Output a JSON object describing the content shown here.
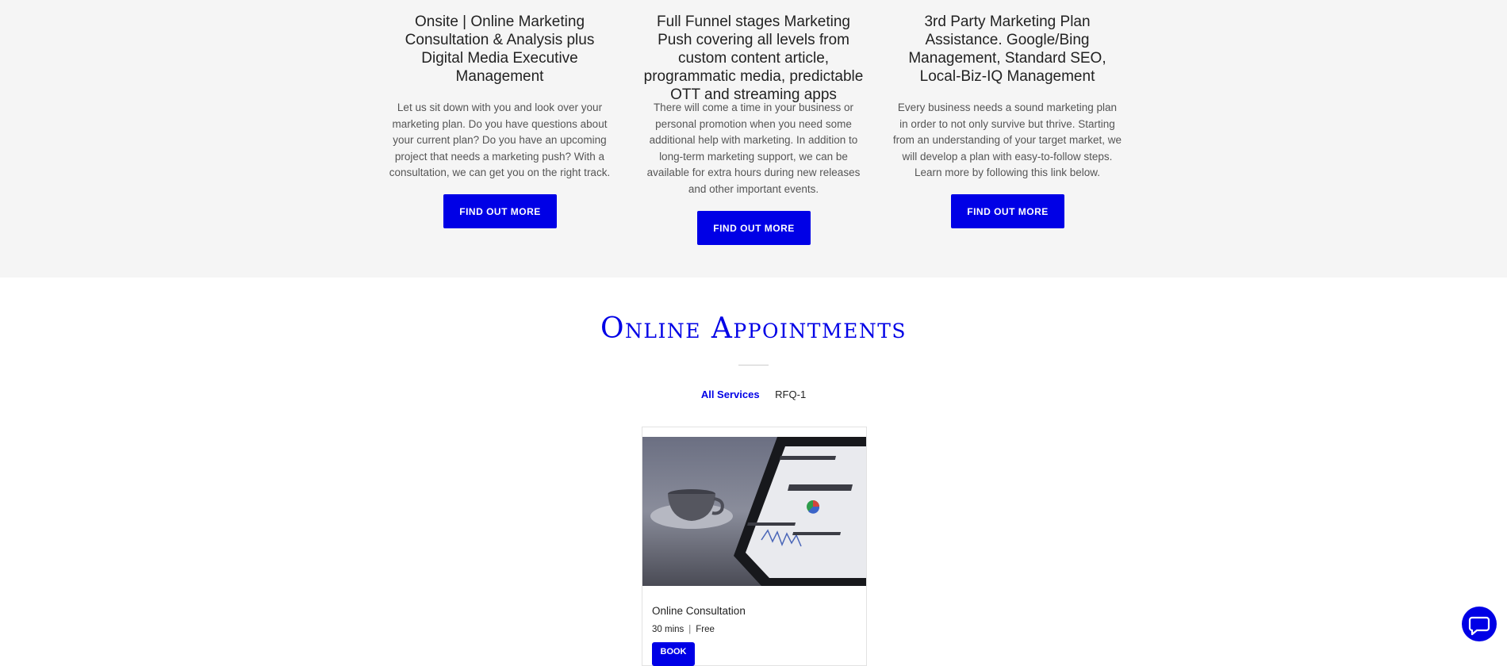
{
  "features": [
    {
      "title": "Onsite | Online Marketing Consultation & Analysis plus Digital Media Executive Management",
      "description": "Let us sit down with you and look over your marketing plan. Do you have questions about your current plan? Do you have an upcoming project that needs a marketing push? With a consultation, we can get you on the right track.",
      "button": "FIND OUT MORE"
    },
    {
      "title": "Full Funnel stages Marketing Push covering all levels from custom content article, programmatic media, predictable OTT and streaming apps",
      "description": "There will come a time in your business or personal promotion when you need some additional help with marketing. In addition to long-term marketing support, we can be available for extra hours during new releases and other important events.",
      "button": "FIND OUT MORE"
    },
    {
      "title": "3rd Party Marketing Plan Assistance. Google/Bing Management, Standard SEO, Local-Biz-IQ Management",
      "description": "Every business needs a sound marketing plan in order to not only survive but thrive. Starting from an understanding of your target market, we will develop a plan with easy-to-follow steps. Learn more by following this link below.",
      "button": "FIND OUT MORE"
    }
  ],
  "appointments": {
    "title": "Online Appointments",
    "tabs": [
      {
        "label": "All Services",
        "active": true
      },
      {
        "label": "RFQ-1",
        "active": false
      }
    ],
    "service": {
      "name": "Online Consultation",
      "duration": "30 mins",
      "separator": "|",
      "price": "Free",
      "book_label": "BOOK"
    }
  },
  "icons": {
    "chat": "chat-bubble-icon"
  },
  "colors": {
    "accent": "#0000e6",
    "section_bg": "#f5f5f5"
  }
}
